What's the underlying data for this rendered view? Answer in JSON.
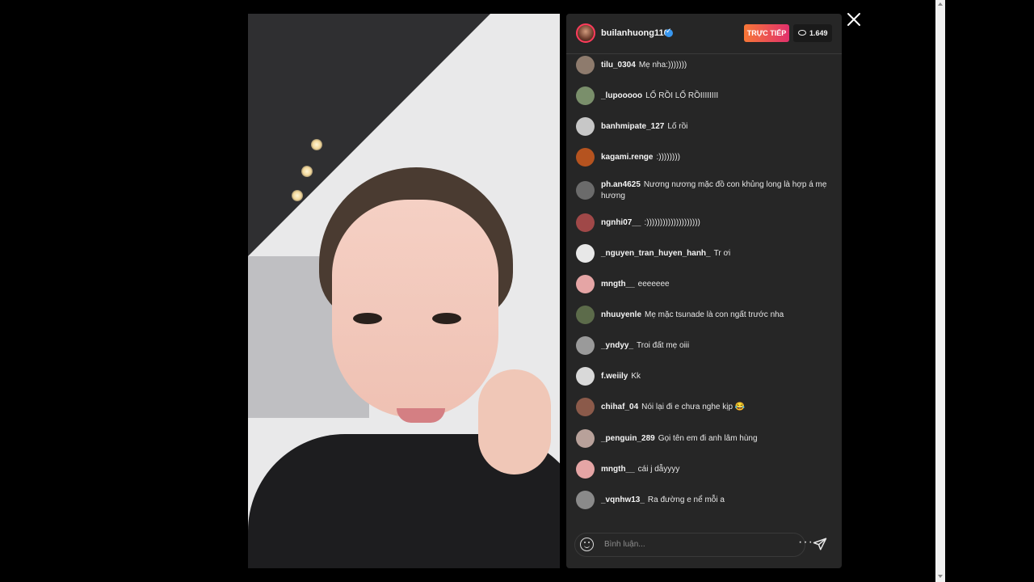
{
  "stream": {
    "host_username": "builanhuong116",
    "live_label": "TRỰC TIẾP",
    "viewer_count": "1.649",
    "verified": true
  },
  "comments": [
    {
      "user": "tilu_0304",
      "text": "Mẹ nha:)))))))",
      "avatar_color": "#8e7b6d"
    },
    {
      "user": "_lupooooo",
      "text": "LỐ RỒI LỐ RỒIIIIIIII",
      "avatar_color": "#7a8f6b"
    },
    {
      "user": "banhmipate_127",
      "text": "Lố rồi",
      "avatar_color": "#c7c7c7"
    },
    {
      "user": "kagami.renge",
      "text": ":))))))))",
      "avatar_color": "#b5531f"
    },
    {
      "user": "ph.an4625",
      "text": "Nương nương mặc đồ con khủng long là hợp á mẹ hương",
      "avatar_color": "#6b6b6b"
    },
    {
      "user": "ngnhi07__",
      "text": ":))))))))))))))))))))",
      "avatar_color": "#a04848"
    },
    {
      "user": "_nguyen_tran_huyen_hanh_",
      "text": "Tr ơi",
      "avatar_color": "#e8e8e8"
    },
    {
      "user": "mngth__",
      "text": "eeeeeee",
      "avatar_color": "#e5a5a5"
    },
    {
      "user": "nhuuyenle",
      "text": "Mẹ mặc tsunade là con ngất trước nha",
      "avatar_color": "#5c6b4a"
    },
    {
      "user": "_yndyy_",
      "text": "Troi đất mẹ oiii",
      "avatar_color": "#9a9a9a"
    },
    {
      "user": "f.weiily",
      "text": "Kk",
      "avatar_color": "#d9d9d9"
    },
    {
      "user": "chihaf_04",
      "text": "Nói lại đi e chưa nghe kịp 😂",
      "avatar_color": "#8b5a4a"
    },
    {
      "user": "_penguin_289",
      "text": "Gọi tên em đi anh lâm hùng",
      "avatar_color": "#b8a19a"
    },
    {
      "user": "mngth__",
      "text": "cái j dẫyyyy",
      "avatar_color": "#e5a5a5"
    },
    {
      "user": "_vqnhw13_",
      "text": "Ra đường e nể mỗi a",
      "avatar_color": "#8a8a8a"
    }
  ],
  "footer": {
    "comment_placeholder": "Bình luận..."
  },
  "colors": {
    "panel_bg": "#262626",
    "live_gradient_start": "#f77737",
    "live_gradient_end": "#e1306c",
    "verified_blue": "#3897f0"
  },
  "icons": [
    "close-icon",
    "emoji-icon",
    "more-icon",
    "send-icon",
    "eye-icon",
    "verified-icon"
  ]
}
